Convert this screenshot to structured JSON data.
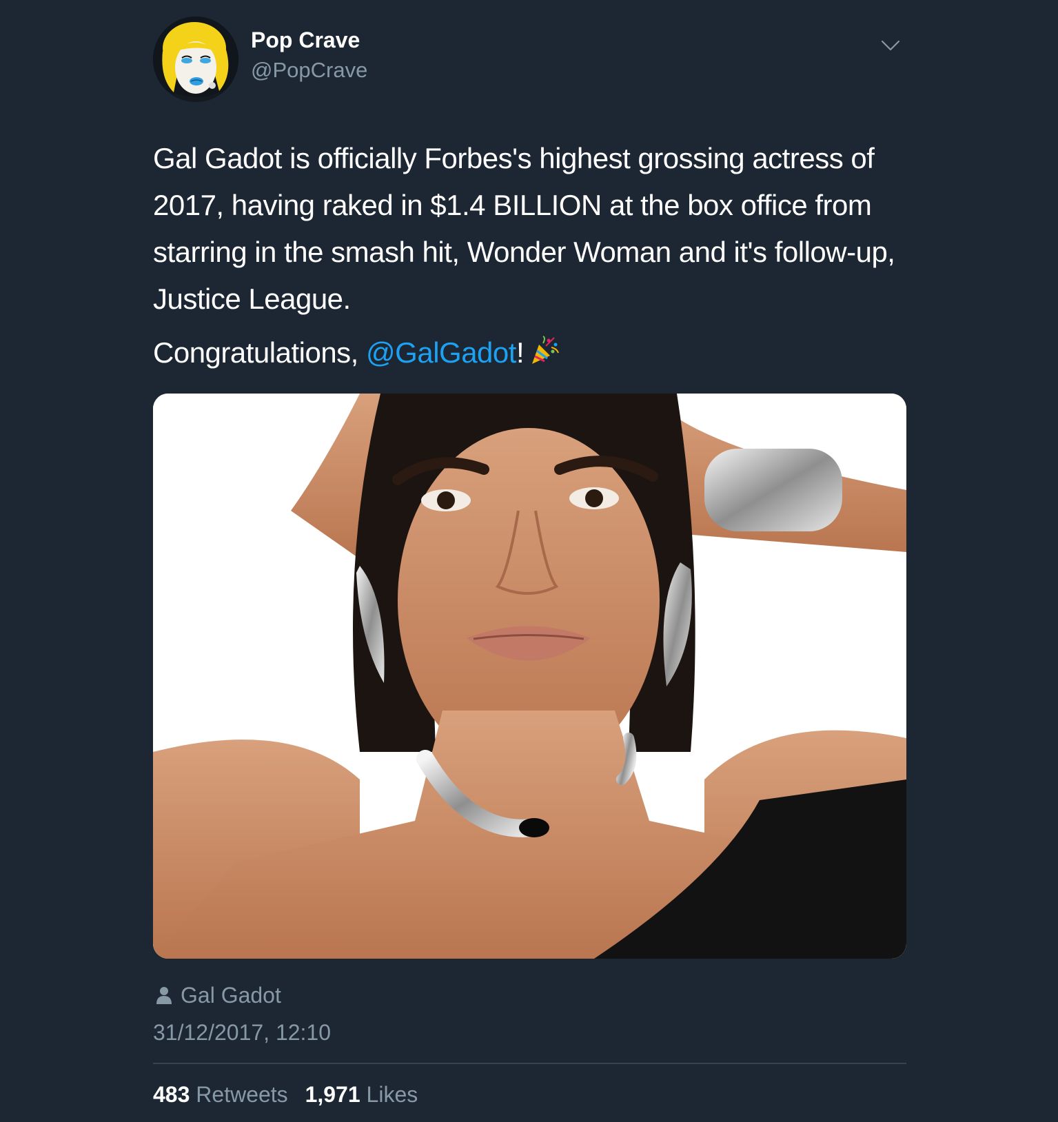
{
  "user": {
    "name": "Pop Crave",
    "handle": "@PopCrave",
    "avatar_icon": "pop-art-avatar"
  },
  "tweet": {
    "text": "Gal Gadot is officially Forbes's highest grossing actress of 2017, having raked in $1.4 BILLION at the box office from starring in the smash hit, Wonder Woman and it's follow-up, Justice League.",
    "congrats_prefix": "Congratulations, ",
    "mention": "@GalGadot",
    "congrats_suffix": "!",
    "emoji_icon": "party-popper-icon"
  },
  "media": {
    "tagged_person": "Gal Gadot"
  },
  "meta": {
    "timestamp": "31/12/2017, 12:10"
  },
  "stats": {
    "retweets_count": "483",
    "retweets_label": "Retweets",
    "likes_count": "1,971",
    "likes_label": "Likes"
  },
  "colors": {
    "background": "#1c2733",
    "text": "#ffffff",
    "secondary": "#8899a6",
    "link": "#1da1f2",
    "divider": "#38444d"
  }
}
